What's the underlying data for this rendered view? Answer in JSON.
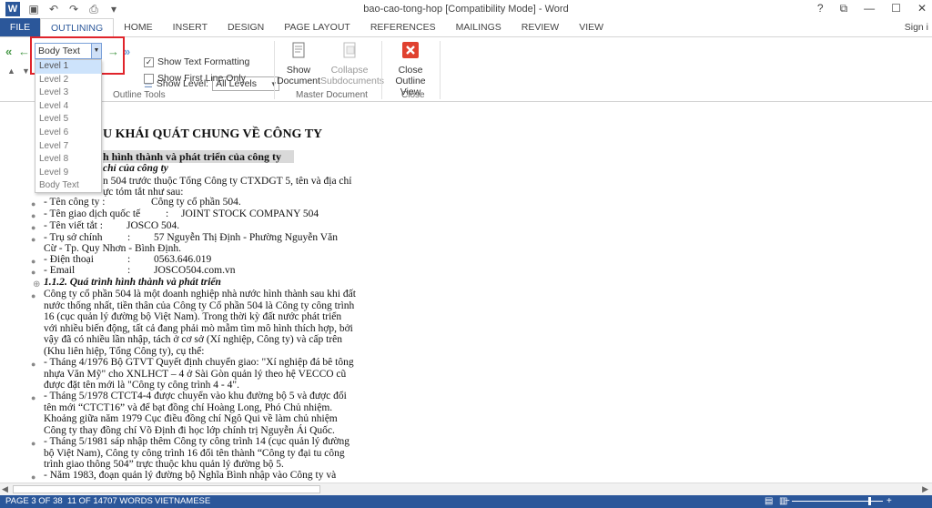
{
  "window": {
    "title": "bao-cao-tong-hop [Compatibility Mode] - Word",
    "controls": [
      "?",
      "⧉",
      "—",
      "☐",
      "✕"
    ]
  },
  "qat": [
    "save-icon",
    "undo-icon",
    "redo-icon",
    "print-icon",
    "customize-icon"
  ],
  "tabs": [
    "FILE",
    "OUTLINING",
    "HOME",
    "INSERT",
    "DESIGN",
    "PAGE LAYOUT",
    "REFERENCES",
    "MAILINGS",
    "REVIEW",
    "VIEW"
  ],
  "signin": "Sign i",
  "outline_tools": {
    "level_value": "Body Text",
    "show_level_label": "Show Level:",
    "show_level_value": "All Levels",
    "show_text_formatting": "Show Text Formatting",
    "show_first_line_only": "Show First Line Only",
    "group_label": "Outline Tools",
    "show_text_formatting_checked": true,
    "show_first_line_only_checked": false
  },
  "master_document": {
    "show_document": "Show\nDocument",
    "collapse_subdocuments": "Collapse\nSubdocuments",
    "group_label": "Master Document"
  },
  "close_group": {
    "close_outline_view": "Close\nOutline View",
    "group_label": "Close"
  },
  "dropdown_items": [
    "Level 1",
    "Level 2",
    "Level 3",
    "Level 4",
    "Level 5",
    "Level 6",
    "Level 7",
    "Level 8",
    "Level 9",
    "Body Text"
  ],
  "document": {
    "h1": "U KHÁI QUÁT CHUNG VỀ CÔNG TY",
    "h2": "h hình thành và phát triển của công ty",
    "h3": "chỉ của công ty",
    "l1": "n 504 trước thuộc Tổng Công ty CTXDGT 5, tên và địa chỉ",
    "l2": "ực tóm tắt như sau:",
    "l3a": "- Tên công ty :",
    "l3b": "Công ty cổ phần 504.",
    "l4a": "- Tên giao dịch quốc tế",
    "l4b": ":",
    "l4c": "JOINT STOCK COMPANY 504",
    "l5a": "- Tên viết tắt :",
    "l5b": "JOSCO 504.",
    "l6a": "- Trụ sở chính",
    "l6b": ":",
    "l6c": "57 Nguyễn Thị Định - Phường Nguyễn Văn",
    "l7": "Cừ - Tp. Quy Nhơn  - Bình Định.",
    "l8a": "- Điện thoại",
    "l8b": ":",
    "l8c": "0563.646.019",
    "l9a": "- Email",
    "l9b": ":",
    "l9c": "JOSCO504.com.vn",
    "h4": "1.1.2. Quá trình hình thành và phát triển",
    "p1": [
      "Công ty cổ phần 504 là một doanh nghiệp nhà nước hình thành sau khi đất",
      "nước thống nhất, tiền thân của Công ty Cổ phần 504 là Công ty công trình",
      "16 (cục quản lý đường bộ Việt Nam). Trong thời kỳ đất nước phát triển",
      "với nhiều biến động, tất cả đang phải mò mẫm tìm mô hình thích hợp, bởi",
      "vậy đã có nhiều lần nhập, tách ở cơ sở (Xí nghiệp, Công ty) và cấp trên",
      "(Khu liên hiệp, Tổng Công ty), cụ thể:"
    ],
    "p2": [
      "- Tháng 4/1976 Bộ GTVT Quyết định chuyển giao: \"Xí nghiệp đá bê tông",
      "nhựa Văn Mỹ\" cho XNLHCT – 4 ở Sài Gòn quản lý theo hệ VECCO cũ",
      "được đặt tên mới là \"Công ty công trình 4 - 4\"."
    ],
    "p3": [
      "- Tháng 5/1978 CTCT4-4 được chuyển vào khu đường bộ 5 và được đổi",
      "tên mới “CTCT16” và để bạt đồng chí Hoàng Long, Phó Chủ nhiệm.",
      "Khoảng giữa năm 1979 Cục điều đồng chí Ngô Qui về làm chủ nhiệm",
      "Công ty thay đồng chí Võ Định đi học lớp chính trị Nguyễn Ái Quốc."
    ],
    "p4": [
      "- Tháng 5/1981 sáp nhập thêm Công ty công trình 14 (cục quản lý đường",
      "bộ Việt Nam), Công ty công trình 16 đổi tên thành “Công ty đại tu công",
      "trình giao thông 504” trực thuộc khu quản lý đường bộ 5."
    ],
    "p5": [
      "- Năm 1983, đoạn quản lý đường bộ Nghĩa Bình nhập vào Công ty và"
    ]
  },
  "status": {
    "page": "PAGE 3 OF 38",
    "words": "11 OF 14707 WORDS",
    "language": "VIETNAMESE"
  },
  "colors": {
    "accent": "#2b579a",
    "highlight_box": "#e0242b",
    "close_icon": "#e0412f"
  }
}
